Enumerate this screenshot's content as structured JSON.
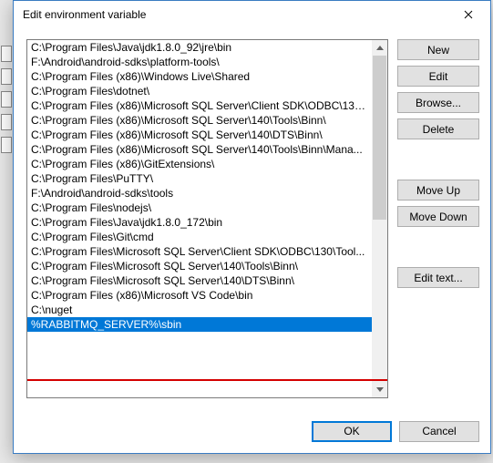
{
  "dialog": {
    "title": "Edit environment variable"
  },
  "listItems": [
    "C:\\Program Files\\Java\\jdk1.8.0_92\\jre\\bin",
    "F:\\Android\\android-sdks\\platform-tools\\",
    "C:\\Program Files (x86)\\Windows Live\\Shared",
    "C:\\Program Files\\dotnet\\",
    "C:\\Program Files (x86)\\Microsoft SQL Server\\Client SDK\\ODBC\\130...",
    "C:\\Program Files (x86)\\Microsoft SQL Server\\140\\Tools\\Binn\\",
    "C:\\Program Files (x86)\\Microsoft SQL Server\\140\\DTS\\Binn\\",
    "C:\\Program Files (x86)\\Microsoft SQL Server\\140\\Tools\\Binn\\Mana...",
    "C:\\Program Files (x86)\\GitExtensions\\",
    "C:\\Program Files\\PuTTY\\",
    "F:\\Android\\android-sdks\\tools",
    "C:\\Program Files\\nodejs\\",
    "C:\\Program Files\\Java\\jdk1.8.0_172\\bin",
    "C:\\Program Files\\Git\\cmd",
    "C:\\Program Files\\Microsoft SQL Server\\Client SDK\\ODBC\\130\\Tool...",
    "C:\\Program Files\\Microsoft SQL Server\\140\\Tools\\Binn\\",
    "C:\\Program Files\\Microsoft SQL Server\\140\\DTS\\Binn\\",
    "C:\\Program Files (x86)\\Microsoft VS Code\\bin",
    "C:\\nuget",
    "%RABBITMQ_SERVER%\\sbin"
  ],
  "selectedIndex": 19,
  "buttons": {
    "new": "New",
    "edit": "Edit",
    "browse": "Browse...",
    "delete": "Delete",
    "moveUp": "Move Up",
    "moveDown": "Move Down",
    "editText": "Edit text...",
    "ok": "OK",
    "cancel": "Cancel"
  }
}
